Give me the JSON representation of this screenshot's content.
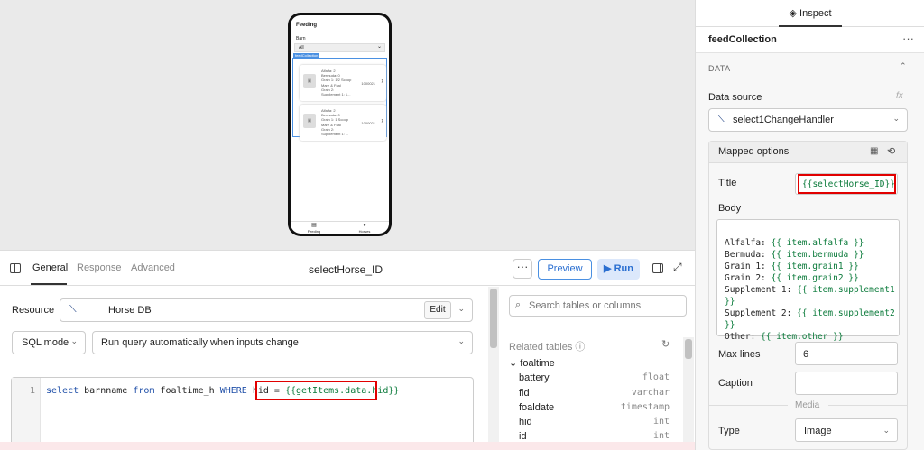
{
  "preview": {
    "title": "Feeding",
    "barn_label": "Barn",
    "barn_value": "All",
    "list_label": "feedCollection",
    "items": [
      {
        "lines": [
          "Alfalfa: 2",
          "Bermuda: 0",
          "Grain 1: 1/2 Scoop",
          "Mare & Foal",
          "Grain 2:",
          "Supplement 1: 1..."
        ],
        "caption": "1000021"
      },
      {
        "lines": [
          "Alfalfa: 2",
          "Bermuda: 0",
          "Grain 1: 1 Scoop",
          "Mare & Foal",
          "Grain 2:",
          "Supplement 1: ..."
        ],
        "caption": "1000021"
      }
    ],
    "nav": [
      "Feeding",
      "Horses"
    ]
  },
  "query": {
    "tabs": [
      "General",
      "Response",
      "Advanced"
    ],
    "name": "selectHorse_ID",
    "more": "···",
    "preview_label": "Preview",
    "run_label": "▶ Run",
    "resource_label": "Resource",
    "resource_value": "Horse DB",
    "edit_label": "Edit",
    "mode_value": "SQL mode",
    "trigger_value": "Run query automatically when inputs change",
    "line_number": "1",
    "code_kw1": "select",
    "code_t1": " barnname ",
    "code_kw2": "from",
    "code_t2": " foaltime_h ",
    "code_kw3": "WHERE",
    "code_t3": " hid = ",
    "code_tpl": "{{getItems.data.hid}}"
  },
  "schema": {
    "search_placeholder": "Search tables or columns",
    "related_label": "Related tables",
    "table": "foaltime",
    "columns": [
      {
        "name": "battery",
        "type": "float"
      },
      {
        "name": "fid",
        "type": "varchar"
      },
      {
        "name": "foaldate",
        "type": "timestamp"
      },
      {
        "name": "hid",
        "type": "int"
      },
      {
        "name": "id",
        "type": "int"
      }
    ]
  },
  "inspect": {
    "tab": "Inspect",
    "component": "feedCollection",
    "section": "DATA",
    "data_source_label": "Data source",
    "fx": "fx",
    "data_source_value": "select1ChangeHandler",
    "mapped_label": "Mapped options",
    "title_label": "Title",
    "title_value": "{{selectHorse_ID}}",
    "body_label": "Body",
    "body_lines": [
      {
        "k": "Alfalfa: ",
        "v": "{{ item.alfalfa }}"
      },
      {
        "k": "Bermuda: ",
        "v": "{{ item.bermuda }}"
      },
      {
        "k": "Grain 1: ",
        "v": "{{ item.grain1 }}"
      },
      {
        "k": "Grain 2: ",
        "v": "{{ item.grain2 }}"
      },
      {
        "k": "Supplement 1: ",
        "v": "{{ item.supplement1"
      },
      {
        "k": "",
        "v": "}}"
      },
      {
        "k": "Supplement 2: ",
        "v": "{{ item.supplement2"
      },
      {
        "k": "",
        "v": "}}"
      },
      {
        "k": "Other: ",
        "v": "{{ item.other }}"
      }
    ],
    "max_lines_label": "Max lines",
    "max_lines_value": "6",
    "caption_label": "Caption",
    "caption_value": "",
    "media_label": "Media",
    "type_label": "Type",
    "type_value": "Image"
  },
  "colors": {
    "accent": "#2a6fd1",
    "highlight": "#e10000",
    "template": "#0a7a3a"
  }
}
